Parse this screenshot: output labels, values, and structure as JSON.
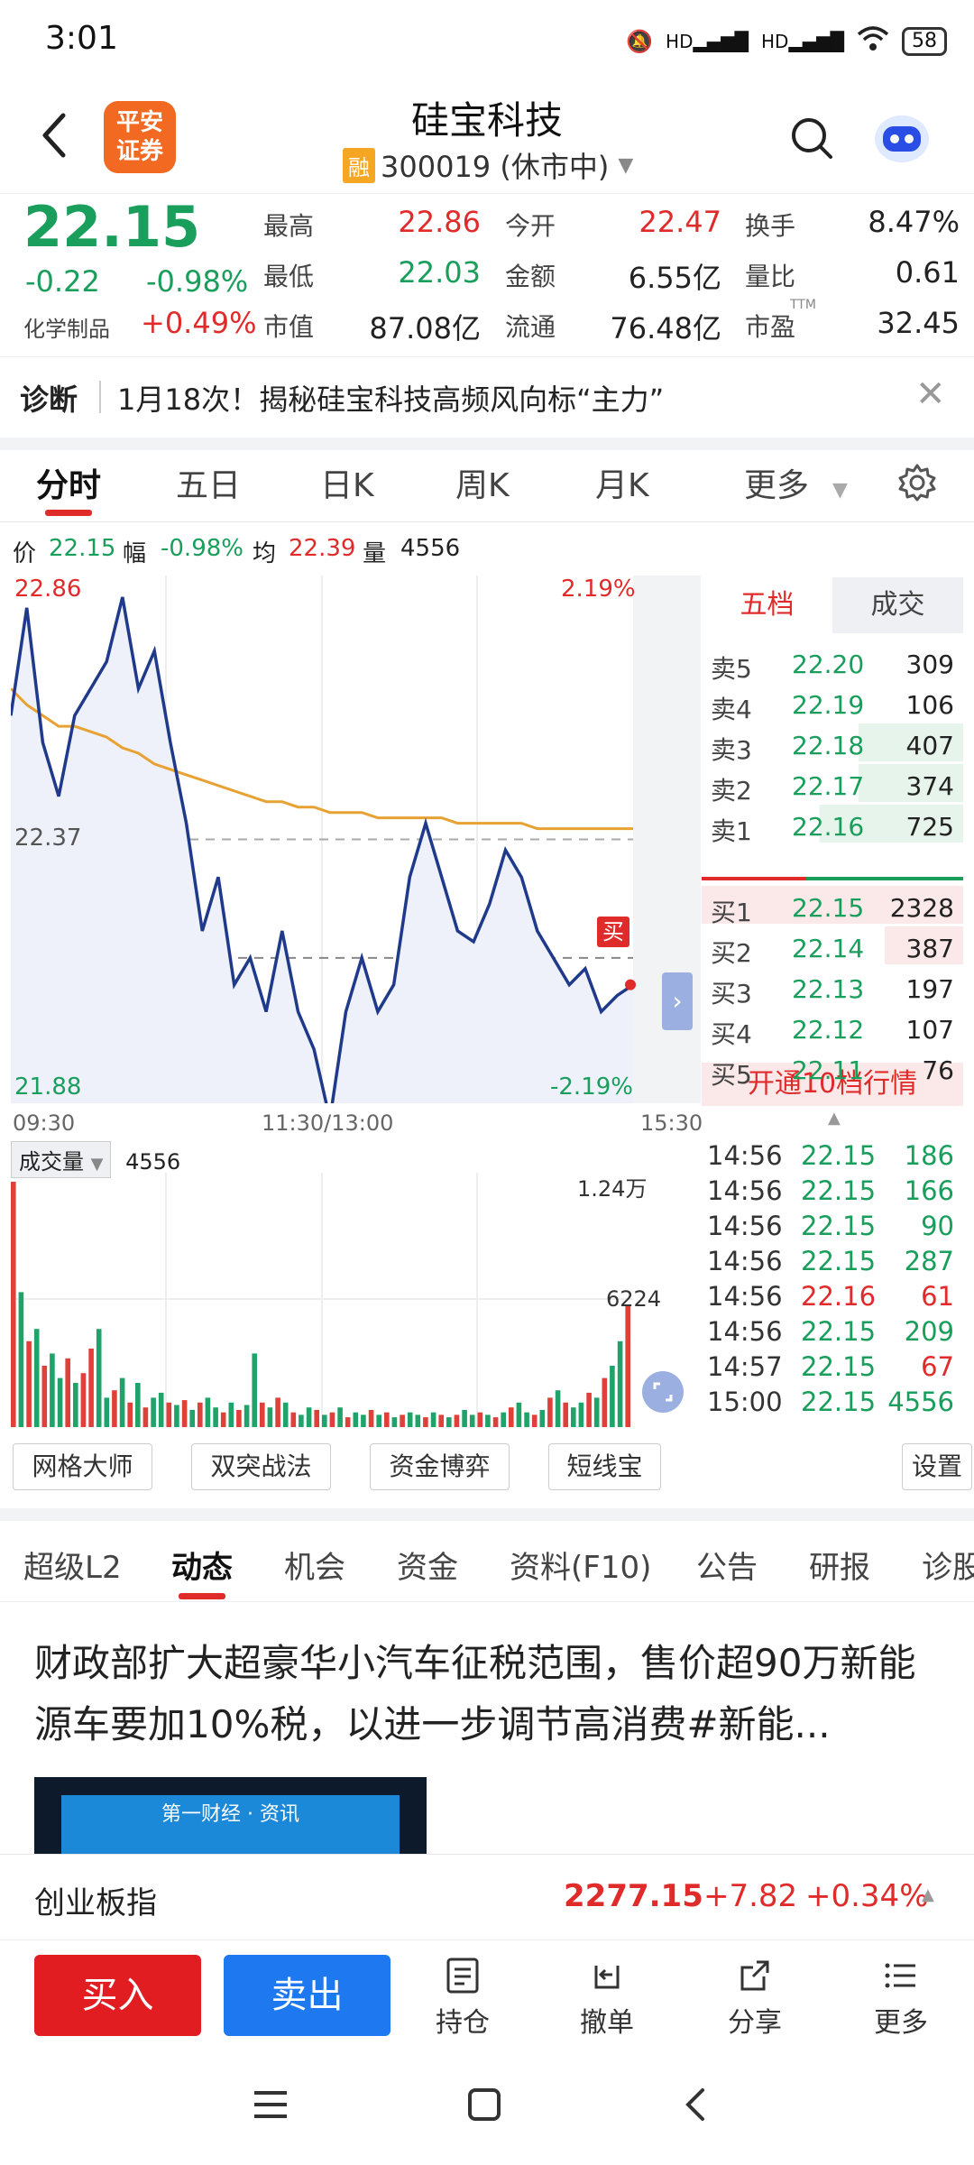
{
  "status": {
    "time": "3:01",
    "signal1": "HD",
    "signal2": "HD",
    "battery": "58"
  },
  "header": {
    "stock_name": "硅宝科技",
    "rong": "融",
    "code_status": "300019 (休市中)",
    "logo_text_1": "平安",
    "logo_text_2": "证券"
  },
  "quote": {
    "price": "22.15",
    "change": "-0.22",
    "change_pct": "-0.98%",
    "sector": "化学制品",
    "sector_pct": "+0.49%",
    "stats": [
      {
        "label": "最高",
        "value": "22.86",
        "color": "#e02b2b"
      },
      {
        "label": "今开",
        "value": "22.47",
        "color": "#e02b2b"
      },
      {
        "label": "换手",
        "value": "8.47%",
        "color": "#222"
      },
      {
        "label": "最低",
        "value": "22.03",
        "color": "#1a9e5c"
      },
      {
        "label": "金额",
        "value": "6.55亿",
        "color": "#222"
      },
      {
        "label": "量比",
        "value": "0.61",
        "color": "#222"
      },
      {
        "label": "市值",
        "value": "87.08亿",
        "color": "#222"
      },
      {
        "label": "流通",
        "value": "76.48亿",
        "color": "#222"
      },
      {
        "label": "市盈",
        "value": "32.45",
        "color": "#222"
      }
    ],
    "ttm": "TTM"
  },
  "news": {
    "tag": "诊断",
    "text": "1月18次！揭秘硅宝科技高频风向标“主力”"
  },
  "chart_tabs": [
    "分时",
    "五日",
    "日K",
    "周K",
    "月K",
    "更多"
  ],
  "info_row": {
    "price_label": "价",
    "price": "22.15",
    "amp_label": "幅",
    "amp": "-0.98%",
    "avg_label": "均",
    "avg": "22.39",
    "vol_label": "量",
    "vol": "4556"
  },
  "chart_labels": {
    "top_left": "22.86",
    "top_right": "2.19%",
    "mid_left": "22.37",
    "bottom_left": "21.88",
    "bottom_right": "-2.19%",
    "buy_marker": "买",
    "time_start": "09:30",
    "time_mid": "11:30/13:00",
    "time_end": "15:30"
  },
  "chart_data": {
    "type": "line",
    "series": [
      {
        "values": [
          22.6,
          22.8,
          22.55,
          22.45,
          22.6,
          22.65,
          22.7,
          22.82,
          22.65,
          22.72,
          22.55,
          22.4,
          22.2,
          22.3,
          22.1,
          22.15,
          22.05,
          22.2,
          22.05,
          21.98,
          21.85,
          22.05,
          22.15,
          22.05,
          22.1,
          22.3,
          22.4,
          22.3,
          22.2,
          22.18,
          22.25,
          22.35,
          22.3,
          22.2,
          22.15,
          22.1,
          22.13,
          22.05,
          22.08,
          22.1
        ]
      },
      {
        "values": [
          22.65,
          22.62,
          22.6,
          22.58,
          22.58,
          22.57,
          22.56,
          22.54,
          22.53,
          22.51,
          22.5,
          22.49,
          22.48,
          22.47,
          22.46,
          22.45,
          22.44,
          22.44,
          22.43,
          22.43,
          22.42,
          22.42,
          22.42,
          22.41,
          22.41,
          22.41,
          22.41,
          22.41,
          22.4,
          22.4,
          22.4,
          22.4,
          22.4,
          22.39,
          22.39,
          22.39,
          22.39,
          22.39,
          22.39,
          22.39
        ]
      }
    ],
    "ylim": [
      21.88,
      22.86
    ]
  },
  "volume": {
    "label": "成交量",
    "value": "4556",
    "top": "1.24万",
    "mid": "6224",
    "bars": [
      1.0,
      0.55,
      0.35,
      0.4,
      0.25,
      0.3,
      0.2,
      0.28,
      0.18,
      0.22,
      0.32,
      0.4,
      0.12,
      0.15,
      0.2,
      0.1,
      0.18,
      0.08,
      0.12,
      0.14,
      0.1,
      0.09,
      0.11,
      0.07,
      0.1,
      0.12,
      0.08,
      0.06,
      0.1,
      0.07,
      0.09,
      0.3,
      0.1,
      0.08,
      0.12,
      0.1,
      0.06,
      0.05,
      0.08,
      0.07,
      0.05,
      0.06,
      0.08,
      0.04,
      0.06,
      0.05,
      0.07,
      0.05,
      0.06,
      0.04,
      0.05,
      0.06,
      0.05,
      0.04,
      0.06,
      0.05,
      0.04,
      0.05,
      0.07,
      0.05,
      0.06,
      0.05,
      0.04,
      0.06,
      0.08,
      0.1,
      0.06,
      0.05,
      0.07,
      0.12,
      0.15,
      0.1,
      0.08,
      0.1,
      0.14,
      0.12,
      0.2,
      0.25,
      0.35,
      0.5
    ],
    "colors": [
      "r",
      "g",
      "r",
      "g",
      "r",
      "g",
      "g",
      "r",
      "g",
      "r",
      "r",
      "g",
      "g",
      "r",
      "g",
      "r",
      "g",
      "r",
      "g",
      "g",
      "r",
      "g",
      "r",
      "g",
      "r",
      "g",
      "g",
      "r",
      "g",
      "r",
      "g",
      "g",
      "r",
      "g",
      "r",
      "g",
      "r",
      "g",
      "g",
      "r",
      "g",
      "r",
      "g",
      "r",
      "g",
      "g",
      "r",
      "g",
      "r",
      "g",
      "r",
      "g",
      "g",
      "r",
      "g",
      "r",
      "g",
      "r",
      "g",
      "g",
      "r",
      "g",
      "r",
      "g",
      "r",
      "g",
      "g",
      "r",
      "g",
      "r",
      "g",
      "r",
      "g",
      "g",
      "r",
      "g",
      "r",
      "g",
      "g",
      "r"
    ]
  },
  "orderbook": {
    "tab1": "五档",
    "tab2": "成交",
    "asks": [
      {
        "label": "卖5",
        "price": "22.20",
        "vol": "309"
      },
      {
        "label": "卖4",
        "price": "22.19",
        "vol": "106"
      },
      {
        "label": "卖3",
        "price": "22.18",
        "vol": "407"
      },
      {
        "label": "卖2",
        "price": "22.17",
        "vol": "374"
      },
      {
        "label": "卖1",
        "price": "22.16",
        "vol": "725"
      }
    ],
    "bids": [
      {
        "label": "买1",
        "price": "22.15",
        "vol": "2328"
      },
      {
        "label": "买2",
        "price": "22.14",
        "vol": "387"
      },
      {
        "label": "买3",
        "price": "22.13",
        "vol": "197"
      },
      {
        "label": "买4",
        "price": "22.12",
        "vol": "107"
      },
      {
        "label": "买5",
        "price": "22.11",
        "vol": "76"
      }
    ],
    "open10": "开通10档行情"
  },
  "ticks": [
    {
      "time": "14:56",
      "price": "22.15",
      "vol": "186",
      "side": "g"
    },
    {
      "time": "14:56",
      "price": "22.15",
      "vol": "166",
      "side": "g"
    },
    {
      "time": "14:56",
      "price": "22.15",
      "vol": "90",
      "side": "g"
    },
    {
      "time": "14:56",
      "price": "22.15",
      "vol": "287",
      "side": "g"
    },
    {
      "time": "14:56",
      "price": "22.16",
      "vol": "61",
      "side": "r"
    },
    {
      "time": "14:56",
      "price": "22.15",
      "vol": "209",
      "side": "g"
    },
    {
      "time": "14:57",
      "price": "22.15",
      "vol": "67",
      "side": "r"
    },
    {
      "time": "15:00",
      "price": "22.15",
      "vol": "4556",
      "side": "g"
    }
  ],
  "tools": [
    "网格大师",
    "双突战法",
    "资金博弈",
    "短线宝",
    "设置"
  ],
  "subtabs": [
    "超级L2",
    "动态",
    "机会",
    "资金",
    "资料(F10)",
    "公告",
    "研报",
    "诊股"
  ],
  "article": {
    "title": "财政部扩大超豪华小汽车征税范围，售价超90万新能源车要加10%税，以进一步调节高消费#新能...",
    "img_text": "第一财经 · 资讯"
  },
  "index": {
    "name": "创业板指",
    "value": "2277.15",
    "change": "+7.82",
    "pct": "+0.34%"
  },
  "actions": {
    "buy": "买入",
    "sell": "卖出",
    "hold": "持仓",
    "cancel": "撤单",
    "share": "分享",
    "more": "更多"
  }
}
